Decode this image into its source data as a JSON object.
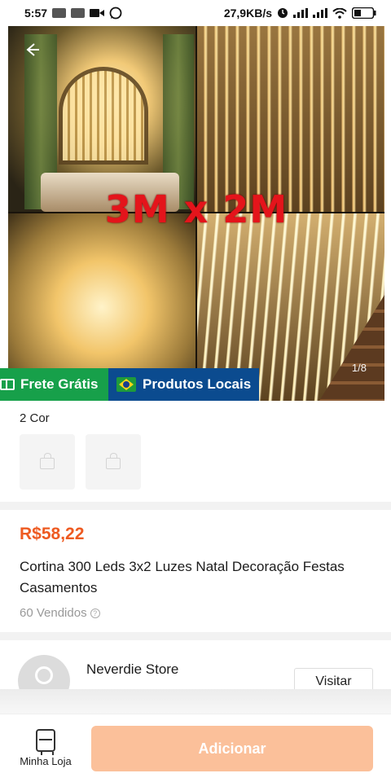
{
  "status_bar": {
    "time": "5:57",
    "speed": "27,9KB/s",
    "notif_badges": [
      "mail",
      "mail"
    ],
    "icons": [
      "video-icon",
      "whatsapp-icon",
      "alarm-icon",
      "signal-icon",
      "signal-icon",
      "wifi-icon",
      "battery-icon"
    ]
  },
  "gallery": {
    "overlay_text": "3M x 2M",
    "page_counter": "1/8",
    "back_icon": "arrow-left-icon"
  },
  "badges": {
    "free_shipping": "Frete Grátis",
    "local_products": "Produtos Locais"
  },
  "variants": {
    "title": "2 Cor",
    "options": [
      "",
      ""
    ]
  },
  "product": {
    "price": "R$58,22",
    "title": "Cortina 300 Leds 3x2 Luzes Natal Decoração Festas Casamentos",
    "sold": "60 Vendidos"
  },
  "store": {
    "name": "Neverdie Store",
    "visit_label": "Visitar"
  },
  "bottom_bar": {
    "shop_label": "Minha Loja",
    "add_label": "Adicionar"
  },
  "colors": {
    "price": "#ee5b22",
    "add_button": "#fbc09a",
    "free_badge": "#17a04a",
    "local_badge": "#0b4b8f",
    "overlay_text": "#e4141b"
  }
}
